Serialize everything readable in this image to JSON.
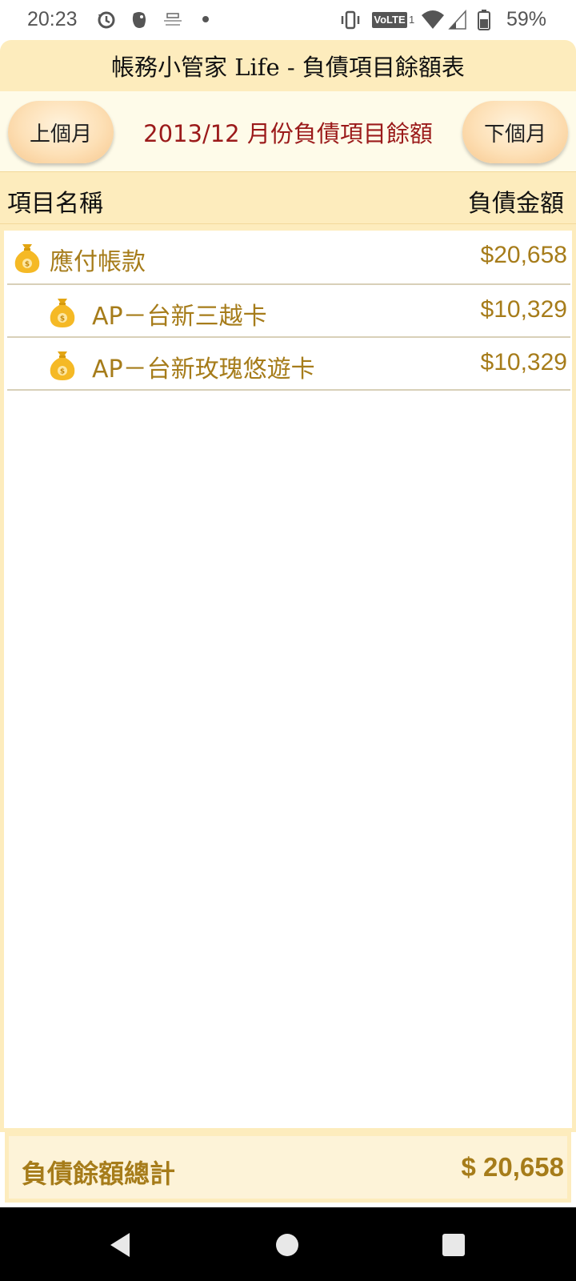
{
  "status_bar": {
    "time": "20:23",
    "volte_label": "VoLTE",
    "sim_slot": "1",
    "battery_percent": "59%",
    "icons": [
      "sync-icon",
      "evernote-icon",
      "app-notification-icon",
      "dot-icon",
      "vibrate-icon",
      "volte-icon",
      "wifi-icon",
      "signal-icon",
      "battery-icon"
    ]
  },
  "app": {
    "title": "帳務小管家 Life - 負債項目餘額表"
  },
  "month_nav": {
    "prev_label": "上個月",
    "next_label": "下個月",
    "current_label": "2013/12 月份負債項目餘額"
  },
  "columns": {
    "name_header": "項目名稱",
    "amount_header": "負債金額"
  },
  "items": [
    {
      "label": "應付帳款",
      "amount": "$20,658",
      "level": 0,
      "icon": "money-bag-icon"
    },
    {
      "label": "AP－台新三越卡",
      "amount": "$10,329",
      "level": 1,
      "icon": "money-bag-icon"
    },
    {
      "label": "AP－台新玫瑰悠遊卡",
      "amount": "$10,329",
      "level": 1,
      "icon": "money-bag-icon"
    }
  ],
  "footer": {
    "total_label": "負債餘額總計",
    "total_value": "$ 20,658"
  },
  "colors": {
    "header_bg": "#fdecbd",
    "item_text": "#a67c1a",
    "month_label": "#9b1a1a",
    "nav_bar": "#000000"
  }
}
